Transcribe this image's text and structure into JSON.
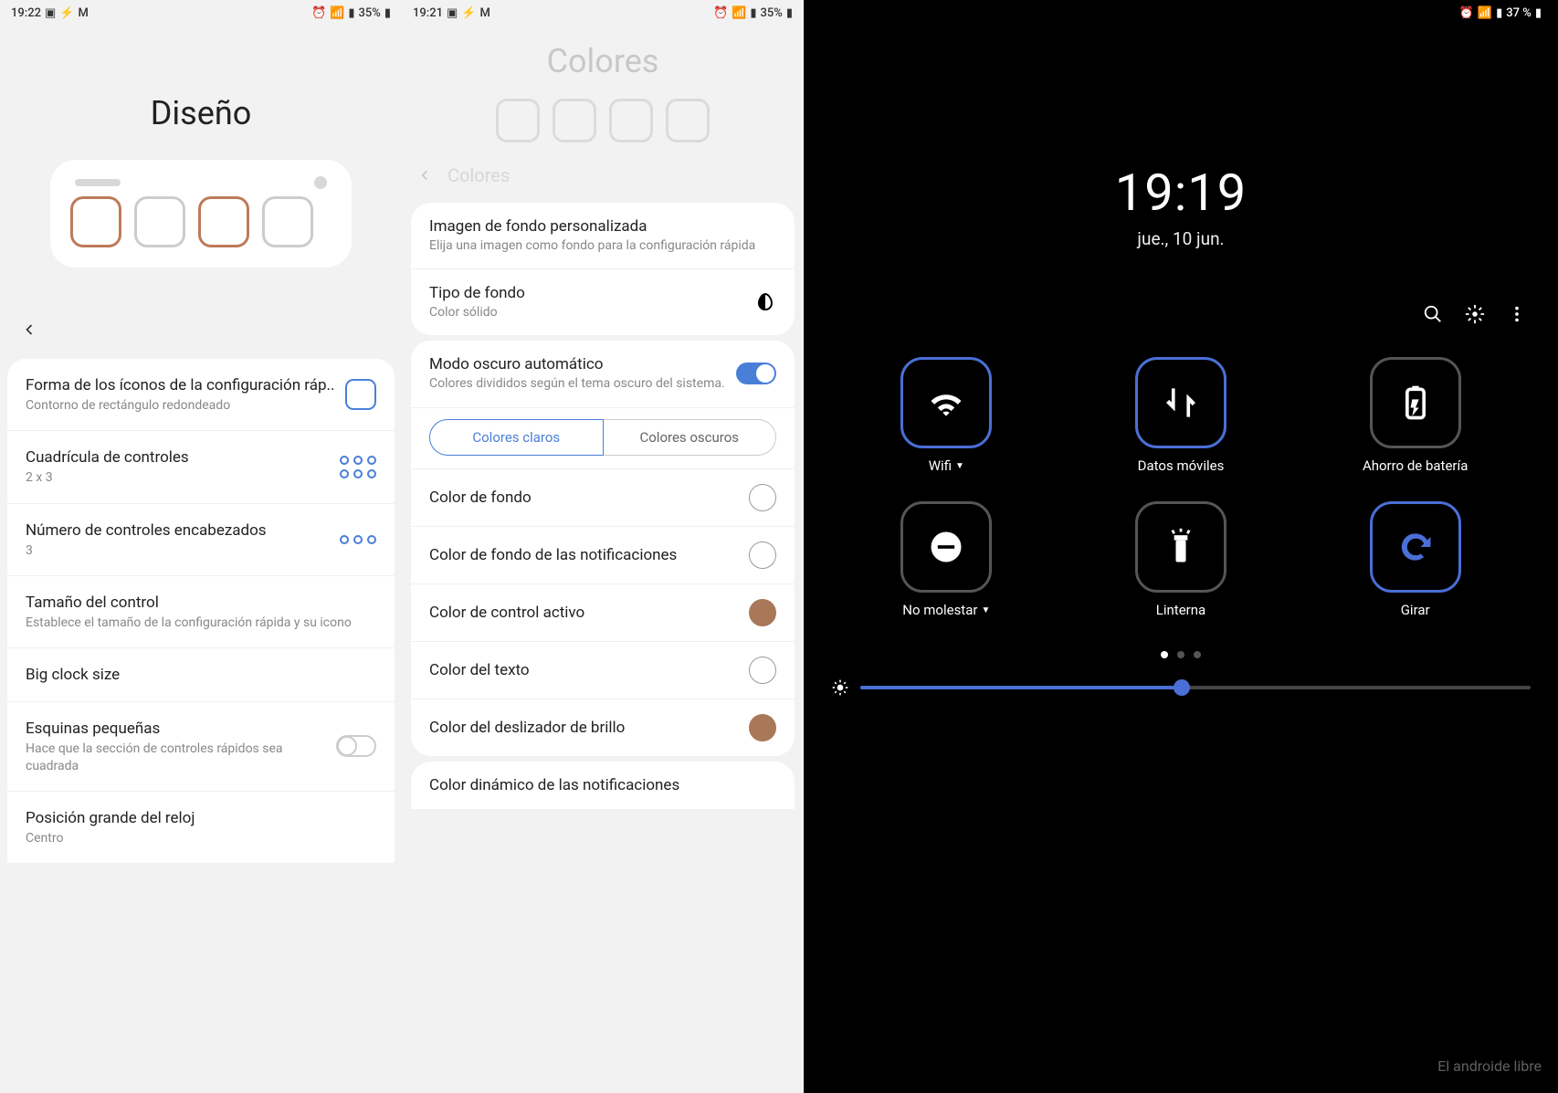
{
  "panel1": {
    "status": {
      "time": "19:22",
      "battery": "35%"
    },
    "title": "Diseño",
    "rows": [
      {
        "title": "Forma de los íconos de la configuración ráp..",
        "sub": "Contorno de rectángulo redondeado"
      },
      {
        "title": "Cuadrícula de controles",
        "sub": "2 x 3"
      },
      {
        "title": "Número de controles encabezados",
        "sub": "3"
      },
      {
        "title": "Tamaño del control",
        "sub": "Establece el tamaño de la configuración rápida y su icono"
      },
      {
        "title": "Big clock size",
        "sub": ""
      },
      {
        "title": "Esquinas pequeñas",
        "sub": "Hace que la sección de controles rápidos sea cuadrada"
      },
      {
        "title": "Posición grande del reloj",
        "sub": "Centro"
      }
    ]
  },
  "panel2": {
    "status": {
      "time": "19:21",
      "battery": "35%"
    },
    "title": "Colores",
    "stickyTitle": "Colores",
    "card1": [
      {
        "title": "Imagen de fondo personalizada",
        "sub": "Elija una imagen como fondo para la configuración rápida"
      },
      {
        "title": "Tipo de fondo",
        "sub": "Color sólido"
      }
    ],
    "darkMode": {
      "title": "Modo oscuro automático",
      "sub": "Colores divididos según el tema oscuro del sistema."
    },
    "tabs": {
      "light": "Colores claros",
      "dark": "Colores oscuros"
    },
    "colors": [
      {
        "label": "Color de fondo",
        "swatch": "white"
      },
      {
        "label": "Color de fondo de las notificaciones",
        "swatch": "white"
      },
      {
        "label": "Color de control activo",
        "swatch": "brown"
      },
      {
        "label": "Color del texto",
        "swatch": "white"
      },
      {
        "label": "Color del deslizador de brillo",
        "swatch": "brown"
      }
    ],
    "dynamicRow": "Color dinámico de las notificaciones"
  },
  "panel3": {
    "status": {
      "battery": "37 %"
    },
    "clock": {
      "time": "19:19",
      "date": "jue., 10 jun."
    },
    "tiles": [
      {
        "label": "Wifi",
        "icon": "wifi",
        "state": "on",
        "dropdown": true
      },
      {
        "label": "Datos móviles",
        "icon": "data",
        "state": "on",
        "dropdown": false
      },
      {
        "label": "Ahorro de batería",
        "icon": "battery-saver",
        "state": "off",
        "dropdown": false
      },
      {
        "label": "No molestar",
        "icon": "dnd",
        "state": "off",
        "dropdown": true
      },
      {
        "label": "Linterna",
        "icon": "flashlight",
        "state": "off",
        "dropdown": false
      },
      {
        "label": "Girar",
        "icon": "rotate",
        "state": "on",
        "dropdown": false
      }
    ],
    "brightness": 48,
    "watermark": "El androide libre"
  }
}
